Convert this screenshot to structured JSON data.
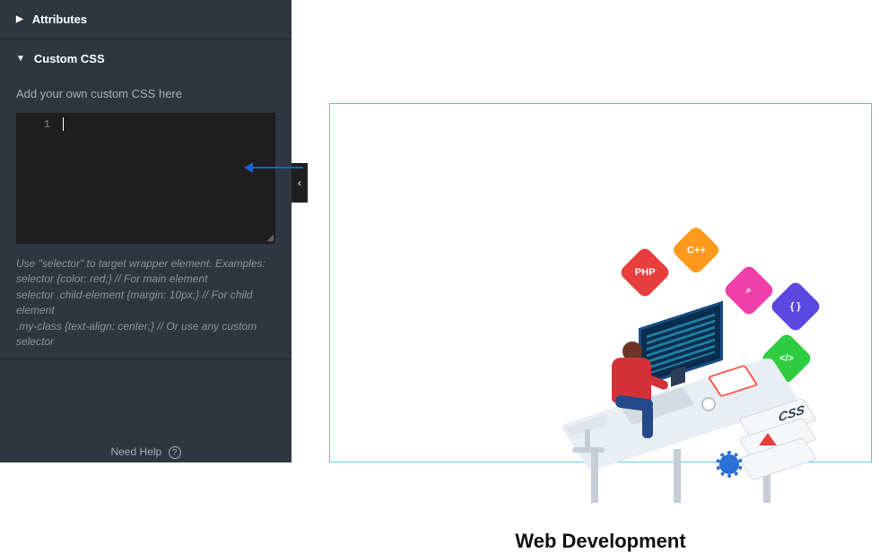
{
  "sidebar": {
    "attributes_label": "Attributes",
    "custom_css_label": "Custom CSS",
    "css_description": "Add your own custom CSS here",
    "editor": {
      "line_number": "1",
      "value": ""
    },
    "help_text": "Use \"selector\" to target wrapper element. Examples:\nselector {color: red;} // For main element\nselector .child-element {margin: 10px;} // For child element\n.my-class {text-align: center;} // Or use any custom selector",
    "need_help_label": "Need Help"
  },
  "preview": {
    "title": "Web Development",
    "tags": {
      "php": "PHP",
      "cpp": "C++",
      "search": "⌕",
      "braces": "{ }",
      "code": "</>"
    },
    "css_stack_label": "CSS"
  },
  "icons": {
    "caret_right": "▶",
    "caret_down": "▼",
    "chevron_left": "‹",
    "question": "?"
  }
}
